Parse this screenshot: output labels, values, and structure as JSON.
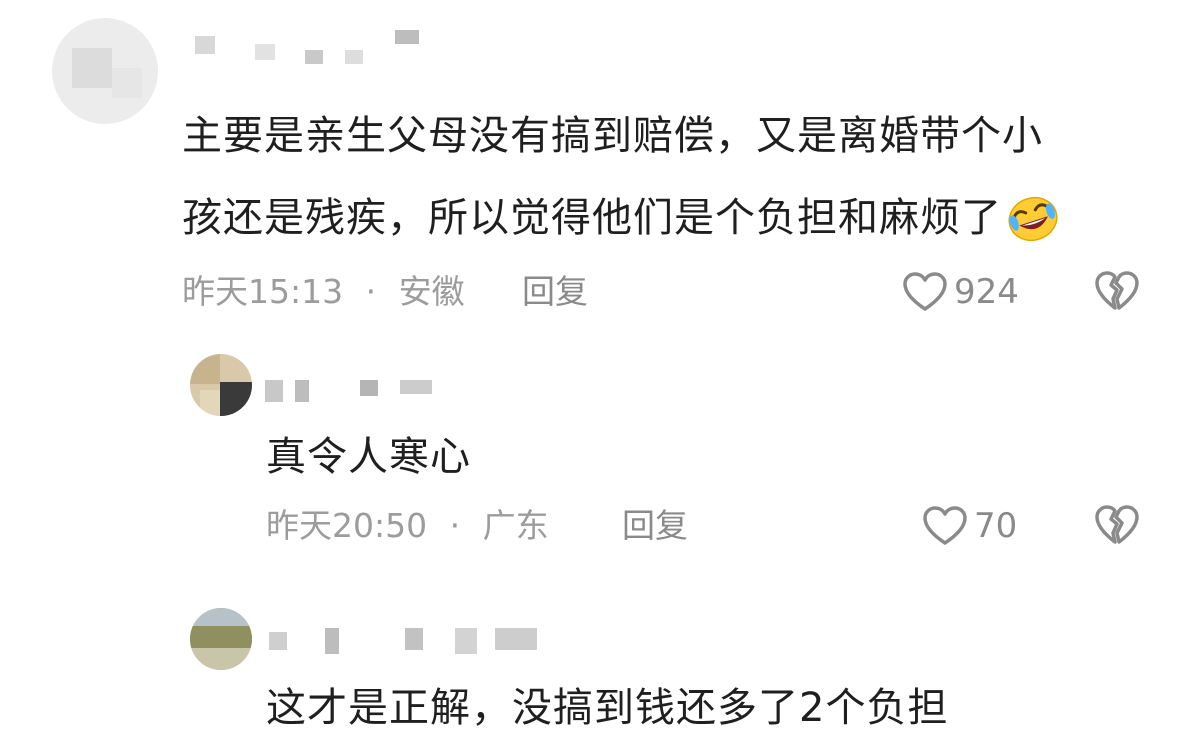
{
  "comments": [
    {
      "text_line1": "主要是亲生父母没有搞到赔偿，又是离婚带个小",
      "text_line2": "孩还是残疾，所以觉得他们是个负担和麻烦了",
      "emoji": "rofl-emoji",
      "time": "昨天15:13",
      "sep": "·",
      "location": "安徽",
      "reply_label": "回复",
      "likes": "924"
    },
    {
      "text": "真令人寒心",
      "time": "昨天20:50",
      "sep": "·",
      "location": "广东",
      "reply_label": "回复",
      "likes": "70"
    },
    {
      "text": "这才是正解，没搞到钱还多了2个负担"
    }
  ],
  "colors": {
    "text": "#1f1f1f",
    "meta": "#9c9c9c",
    "icon": "#8a8a8a",
    "background": "#ffffff"
  },
  "icons": [
    "heart-outline-icon",
    "broken-heart-icon",
    "rofl-emoji"
  ]
}
